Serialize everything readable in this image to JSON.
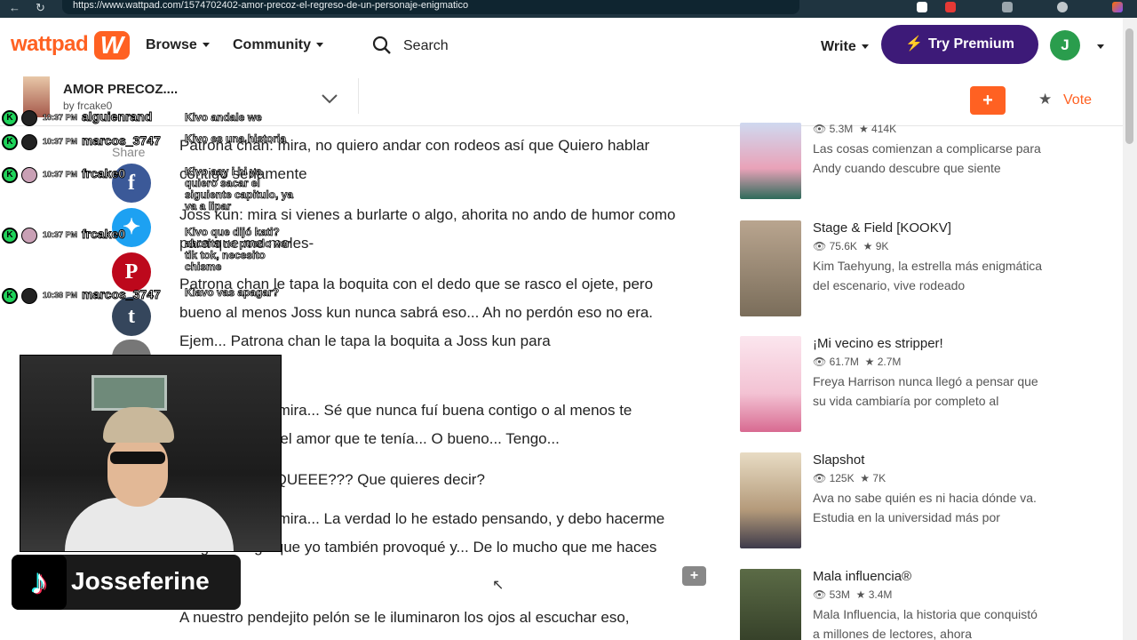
{
  "browser": {
    "url": "https://www.wattpad.com/1574702402-amor-precoz-el-regreso-de-un-personaje-enigmatico"
  },
  "header": {
    "logo": "wattpad",
    "logo_mark": "W",
    "browse": "Browse",
    "community": "Community",
    "search": "Search",
    "write": "Write",
    "premium": "Try Premium",
    "avatar_initial": "J"
  },
  "story": {
    "title": "AMOR PRECOZ....",
    "author": "by frcake0",
    "vote": "Vote",
    "add": "+"
  },
  "reading": {
    "paragraphs": [
      "Patrona chan: mira, no quiero andar con rodeos así que Quiero hablar contigo seriamente",
      "Joss kun: mira si vienes a burlarte o algo, ahorita no ando de humor como para que me moles-",
      "Patrona chan le tapa la boquita  con el dedo que se rasco el ojete, pero bueno al menos Joss kun nunca sabrá eso... Ah no perdón eso no era. Ejem... Patrona chan le tapa la boquita a Joss kun para",
      "Patrona chan: mira... Sé que nunca fuí buena contigo o al menos te demostré todo el amor que te tenía... O bueno... Tengo...",
      "Joss kun: ¿¿¿QUEEE??? Que quieres decir?",
      "Patrona chan: mira... La verdad lo he estado pensando, y debo hacerme cargo de algo que yo también provoqué y... De lo mucho que me haces falta",
      "A nuestro pendejito pelón se le iluminaron los ojos al escuchar eso,"
    ]
  },
  "share": {
    "label": "Share"
  },
  "sidebar": {
    "recommendations": [
      {
        "title": "",
        "reads": "5.3M",
        "votes": "414K",
        "desc": "Las cosas comienzan a complicarse para Andy cuando descubre que siente",
        "cover": "#e9a2b8"
      },
      {
        "title": "Stage & Field [KOOKV]",
        "reads": "75.6K",
        "votes": "9K",
        "desc": "Kim Taehyung, la estrella más enigmática del escenario, vive rodeado",
        "cover": "#b9a58f"
      },
      {
        "title": "¡Mi vecino es stripper!",
        "reads": "61.7M",
        "votes": "2.7M",
        "desc": "Freya Harrison nunca llegó a pensar que su vida cambiaría por completo al",
        "cover": "#f3c2d3"
      },
      {
        "title": "Slapshot",
        "reads": "125K",
        "votes": "7K",
        "desc": "Ava no sabe quién es ni hacia dónde va. Estudia en la universidad más por",
        "cover": "#d9cbb0"
      },
      {
        "title": "Mala influencia®",
        "reads": "53M",
        "votes": "3.4M",
        "desc": "Mala Influencia, la historia que conquistó a millones de lectores, ahora",
        "cover": "#3b4a2f"
      }
    ]
  },
  "chat": [
    {
      "time": "10:37 PM",
      "user": "alguienrand",
      "msg": "Kivo andale we"
    },
    {
      "time": "10:37 PM",
      "user": "marcos_3747",
      "msg": "Kivo es una historia"
    },
    {
      "time": "10:37 PM",
      "user": "frcake0",
      "msg": "Kivo aay i hi ya quiero sacar el siguiente capitulo, ya va a lipar"
    },
    {
      "time": "10:37 PM",
      "user": "frcake0",
      "msg": "Kivo que dijó kati? ahorita no puedo ver tik tok, necesito chisme"
    },
    {
      "time": "10:38 PM",
      "user": "marcos_3747",
      "msg": "Kiavo vas apagar?"
    }
  ],
  "stream": {
    "tiktok_logo": "♪",
    "handle": "Josseferine"
  }
}
